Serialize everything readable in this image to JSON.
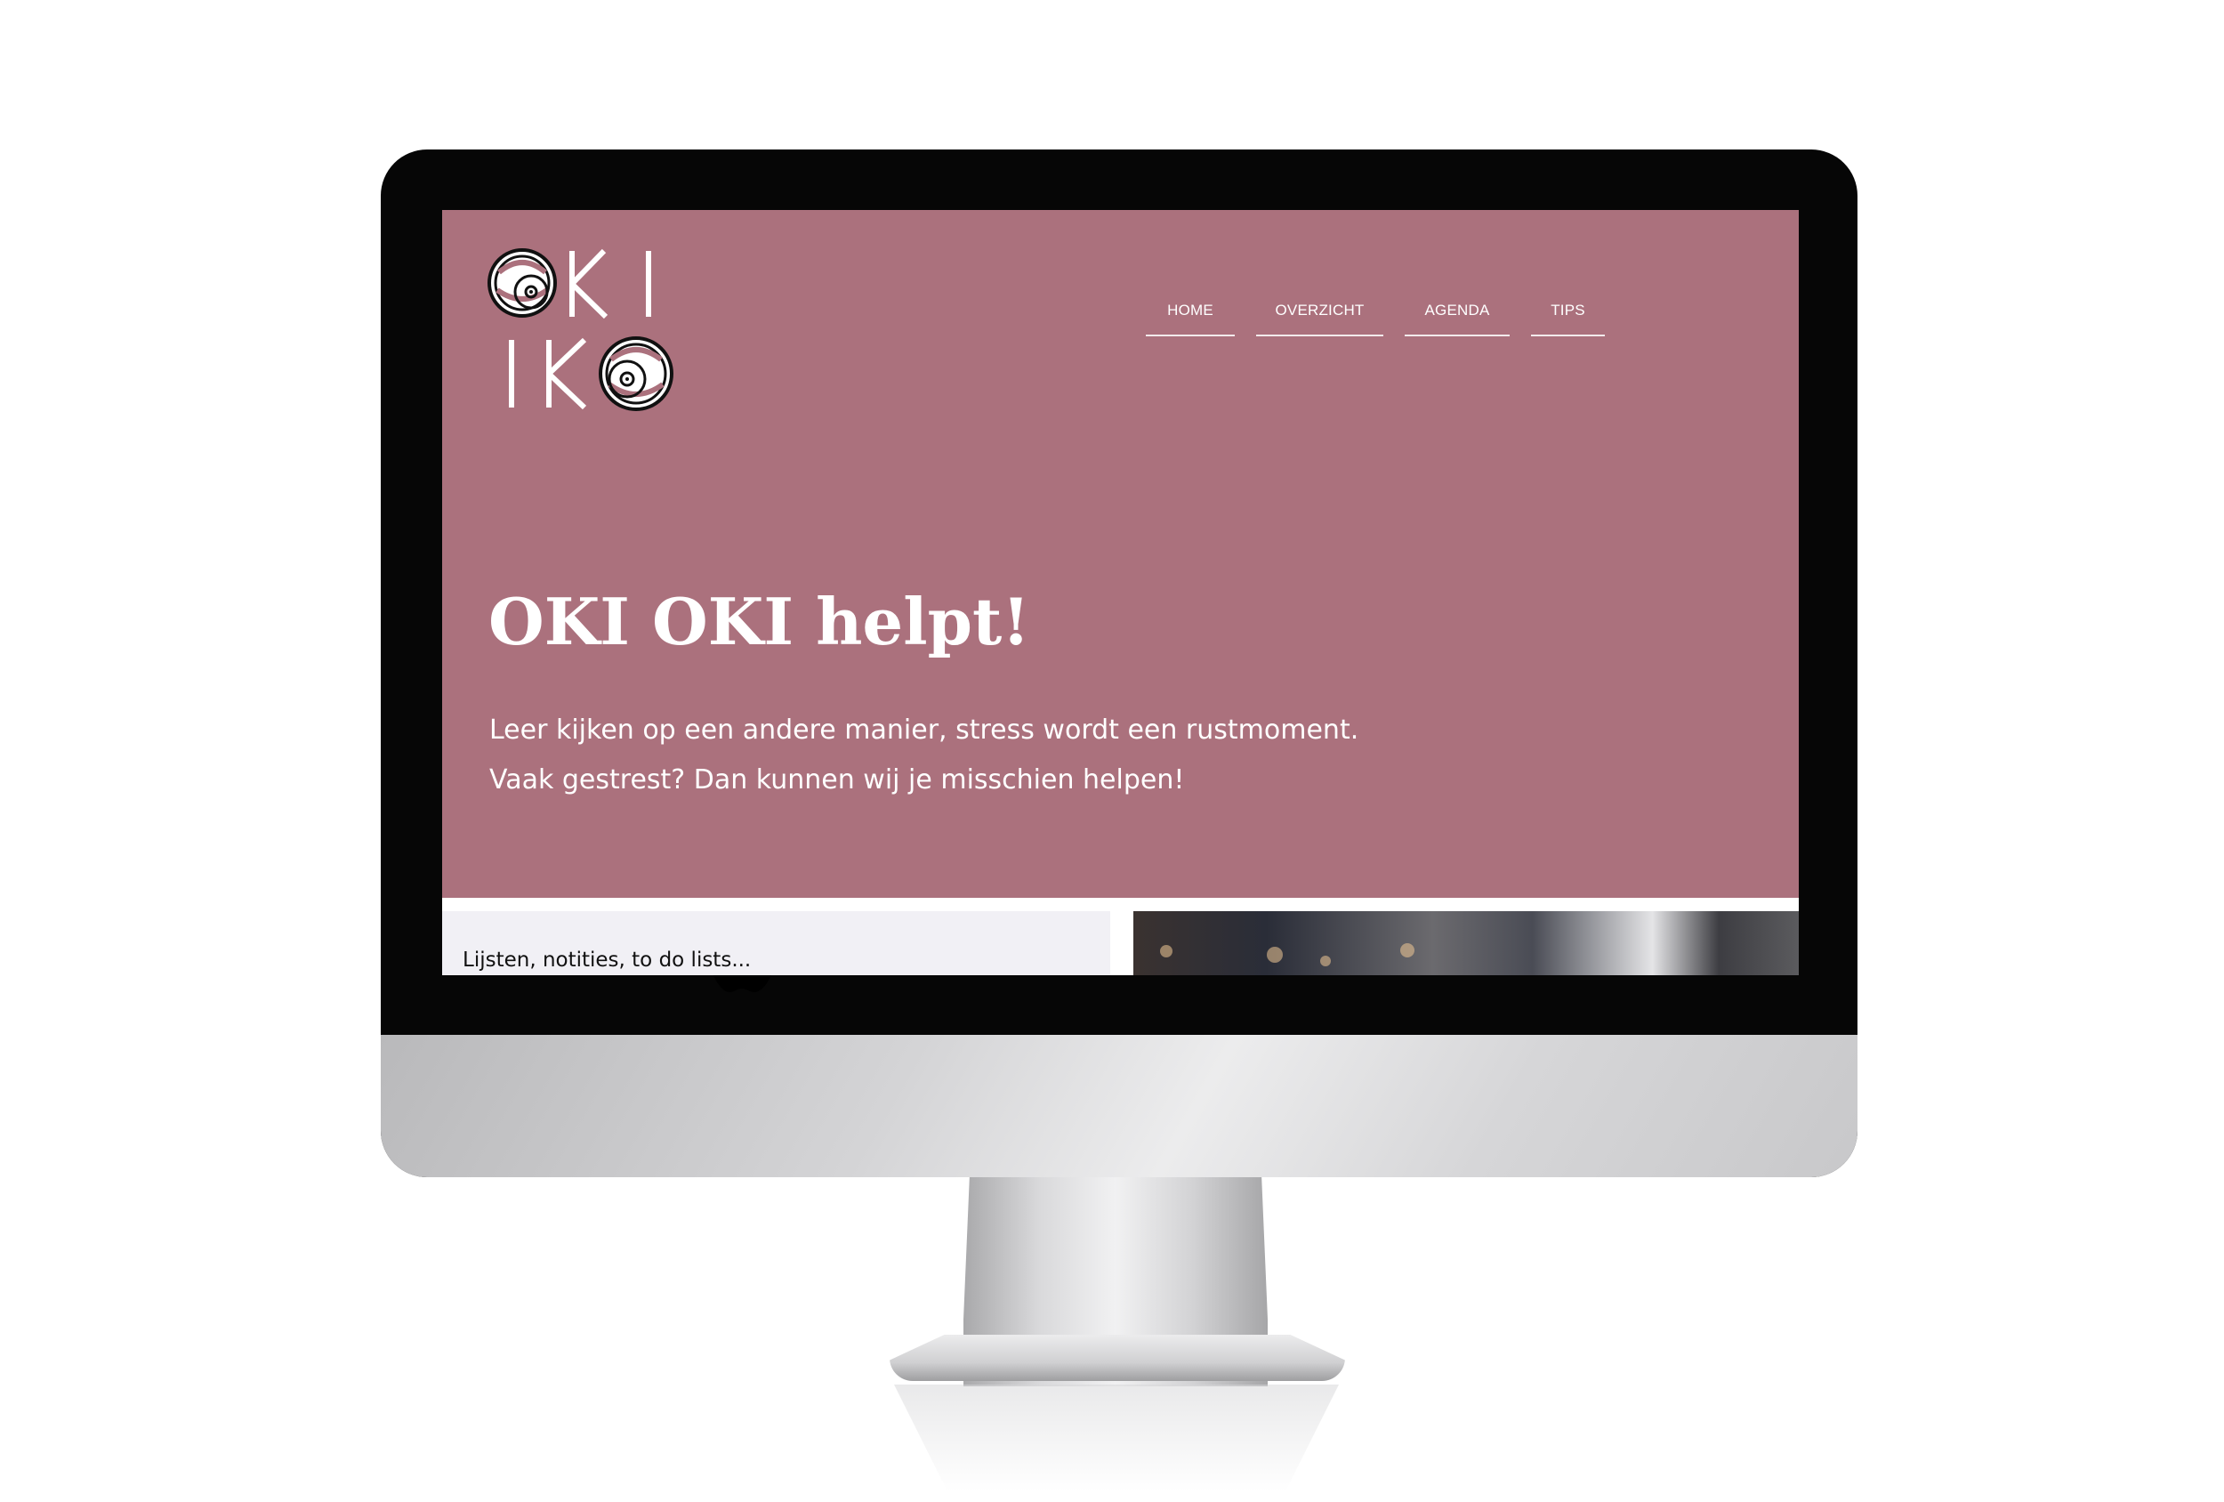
{
  "site": {
    "logo_text": "OKI OKI",
    "nav": {
      "items": [
        {
          "label": "HOME"
        },
        {
          "label": "OVERZICHT"
        },
        {
          "label": "AGENDA"
        },
        {
          "label": "TIPS"
        }
      ]
    },
    "hero": {
      "title": "OKI OKI helpt!",
      "line1": "Leer kijken op een andere manier, stress wordt een rustmoment.",
      "line2": "Vaak gestrest? Dan kunnen wij je misschien helpen!"
    },
    "card": {
      "text": "Lijsten, notities, to do lists..."
    }
  },
  "colors": {
    "hero_bg": "#ab717d",
    "bezel": "#060606",
    "card_bg": "#f1f0f5"
  },
  "icons": {
    "device": "imac-monitor",
    "brand": "apple-logo-icon"
  }
}
